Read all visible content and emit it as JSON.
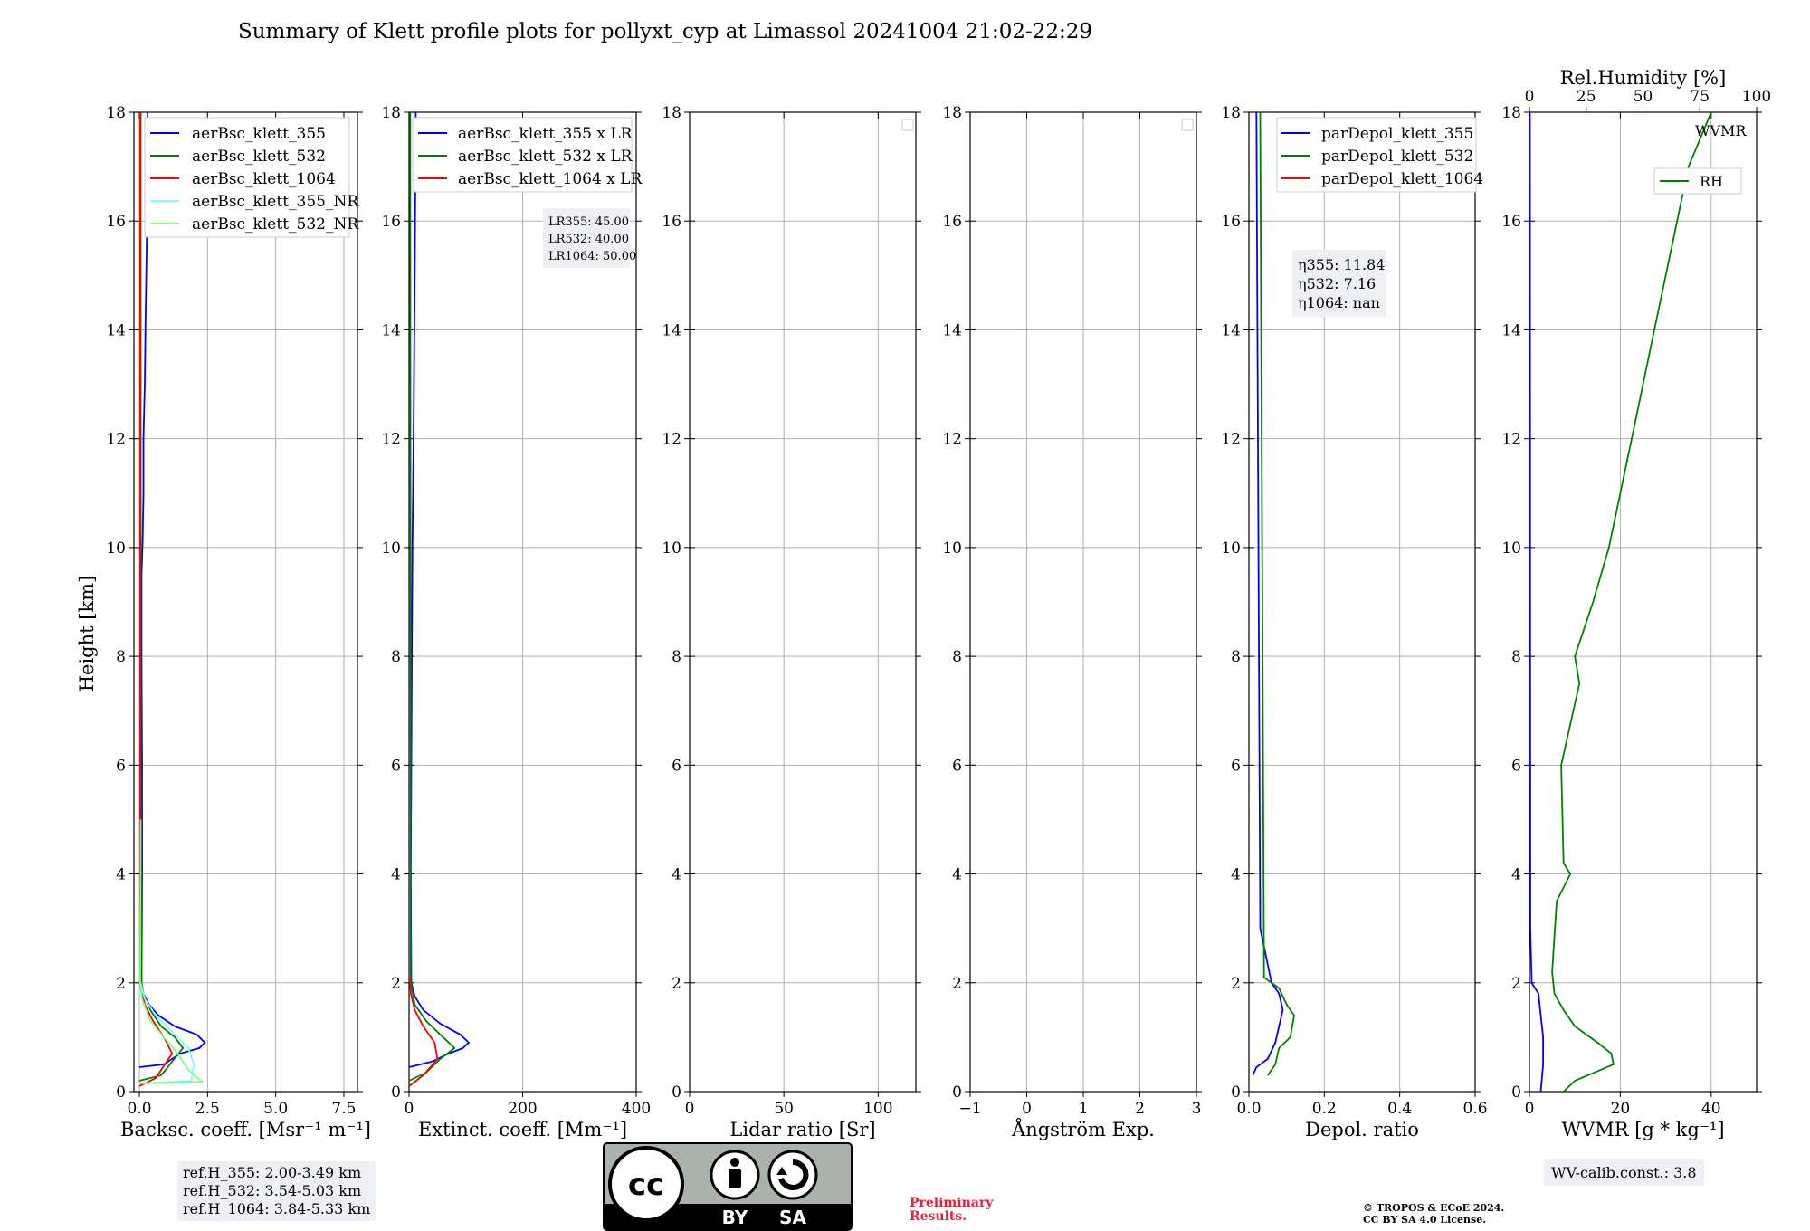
{
  "title": "Summary of Klett profile plots for pollyxt_cyp at Limassol 20241004 21:02-22:29",
  "ylabel": "Height [km]",
  "y_ticks": [
    "0",
    "2",
    "4",
    "6",
    "8",
    "10",
    "12",
    "14",
    "16",
    "18"
  ],
  "panels": [
    {
      "xlabel": "Backsc. coeff. [Msr⁻¹ m⁻¹]",
      "xticks": [
        "0.0",
        "2.5",
        "5.0",
        "7.5"
      ]
    },
    {
      "xlabel": "Extinct. coeff. [Mm⁻¹]",
      "xticks": [
        "0",
        "200",
        "400"
      ]
    },
    {
      "xlabel": "Lidar ratio [Sr]",
      "xticks": [
        "0",
        "50",
        "100"
      ]
    },
    {
      "xlabel": "Ångström Exp.",
      "xticks": [
        "−1",
        "0",
        "1",
        "2",
        "3"
      ]
    },
    {
      "xlabel": "Depol. ratio",
      "xticks": [
        "0.0",
        "0.2",
        "0.4",
        "0.6"
      ]
    },
    {
      "xlabel": "WVMR [g * kg⁻¹]",
      "xticks": [
        "0",
        "20",
        "40"
      ],
      "top_label": "Rel.Humidity [%]",
      "top_ticks": [
        "0",
        "25",
        "50",
        "75",
        "100"
      ]
    }
  ],
  "legends": {
    "bsc": [
      "aerBsc_klett_355",
      "aerBsc_klett_532",
      "aerBsc_klett_1064",
      "aerBsc_klett_355_NR",
      "aerBsc_klett_532_NR"
    ],
    "ext": [
      "aerBsc_klett_355 x LR",
      "aerBsc_klett_532 x LR",
      "aerBsc_klett_1064 x LR"
    ],
    "dep": [
      "parDepol_klett_355",
      "parDepol_klett_532",
      "parDepol_klett_1064"
    ],
    "wv": [
      "WVMR",
      "RH"
    ]
  },
  "lr_box": [
    "LR355: 45.00",
    "LR532: 40.00",
    "LR1064: 50.00"
  ],
  "eta_box": [
    "η355: 11.84",
    "η532: 7.16",
    "η1064: nan"
  ],
  "ref_box": [
    "ref.H_355: 2.00-3.49 km",
    "ref.H_532: 3.54-5.03 km",
    "ref.H_1064: 3.84-5.33 km"
  ],
  "wv_calib": "WV-calib.const.: 3.8",
  "preliminary": [
    "Preliminary",
    "Results."
  ],
  "copyright": [
    "© TROPOS & ECoE 2024.",
    "CC BY SA 4.0 License."
  ],
  "cc_badge": [
    "BY",
    "SA"
  ],
  "colors": {
    "ch355": "#0000ff",
    "ch532": "#008000",
    "ch1064": "#ff0000",
    "nr355": "#7fffff",
    "nr532": "#7fff7f",
    "grid": "#b0b0b0"
  },
  "chart_data": [
    {
      "type": "line",
      "panel": "backscatter",
      "xlim": [
        -0.2,
        8
      ],
      "ylim": [
        0,
        18
      ],
      "series": [
        {
          "name": "aerBsc_klett_355",
          "x": [
            0,
            0.9,
            1.5,
            2.2,
            2.4,
            2.1,
            1.3,
            0.7,
            0.35,
            0.15,
            0.08,
            0.1,
            0.1,
            0.08,
            0.08,
            0.12,
            0.15,
            0.15,
            0.2,
            0.22,
            0.25,
            0.28,
            0.3
          ],
          "y": [
            0.45,
            0.5,
            0.7,
            0.8,
            0.9,
            1.05,
            1.2,
            1.4,
            1.6,
            1.8,
            2.0,
            4,
            6,
            8,
            9.5,
            10.1,
            11,
            12,
            13,
            14,
            15,
            16,
            18
          ]
        },
        {
          "name": "aerBsc_klett_532",
          "x": [
            0,
            0.8,
            1.6,
            1.3,
            0.8,
            0.4,
            0.15,
            0.08,
            0.06,
            0.05,
            0.05,
            0.05
          ],
          "y": [
            0.2,
            0.3,
            0.8,
            1.0,
            1.2,
            1.5,
            1.8,
            2.0,
            4,
            6,
            10,
            18
          ]
        },
        {
          "name": "aerBsc_klett_1064",
          "x": [
            0,
            0.6,
            1.2,
            0.9,
            0.5,
            0.2,
            0.08,
            0.03,
            0.03,
            0.03
          ],
          "y": [
            0.1,
            0.25,
            0.7,
            1.0,
            1.3,
            1.6,
            1.9,
            2.1,
            10,
            18
          ]
        },
        {
          "name": "aerBsc_klett_355_NR",
          "x": [
            0,
            1.9,
            2.0,
            1.8,
            1.2,
            0.6,
            0.2,
            0.05
          ],
          "y": [
            0.15,
            0.2,
            0.5,
            0.8,
            1.1,
            1.4,
            1.7,
            2.0
          ]
        },
        {
          "name": "aerBsc_klett_532_NR",
          "x": [
            0,
            2.3,
            1.8,
            1.4,
            0.9,
            0.4,
            0.1,
            0.03,
            0.05
          ],
          "y": [
            0.15,
            0.18,
            0.4,
            0.7,
            1.0,
            1.3,
            1.7,
            2.0,
            5
          ]
        }
      ]
    },
    {
      "type": "line",
      "panel": "extinction",
      "xlim": [
        0,
        400
      ],
      "ylim": [
        0,
        18
      ],
      "series": [
        {
          "name": "aerBsc_klett_355 x LR",
          "x": [
            0,
            40,
            70,
            95,
            105,
            90,
            55,
            25,
            10,
            4,
            3,
            5,
            6,
            8,
            10,
            12
          ],
          "y": [
            0.45,
            0.55,
            0.7,
            0.8,
            0.9,
            1.05,
            1.25,
            1.5,
            1.75,
            2.0,
            4,
            8,
            10.1,
            12,
            15,
            18
          ]
        },
        {
          "name": "aerBsc_klett_532 x LR",
          "x": [
            0,
            30,
            55,
            80,
            60,
            30,
            10,
            3,
            2
          ],
          "y": [
            0.2,
            0.35,
            0.6,
            0.8,
            1.0,
            1.3,
            1.6,
            2.0,
            18
          ]
        },
        {
          "name": "aerBsc_klett_1064 x LR",
          "x": [
            0,
            25,
            50,
            45,
            25,
            10,
            3,
            1
          ],
          "y": [
            0.1,
            0.3,
            0.6,
            0.9,
            1.2,
            1.5,
            1.8,
            2.1
          ]
        }
      ]
    },
    {
      "type": "line",
      "panel": "lidar_ratio",
      "xlim": [
        0,
        120
      ],
      "ylim": [
        0,
        18
      ],
      "series": []
    },
    {
      "type": "line",
      "panel": "angstrom",
      "xlim": [
        -1,
        3
      ],
      "ylim": [
        0,
        18
      ],
      "series": []
    },
    {
      "type": "line",
      "panel": "depolarization",
      "xlim": [
        0,
        0.6
      ],
      "ylim": [
        0,
        18
      ],
      "series": [
        {
          "name": "parDepol_klett_355",
          "x": [
            0.01,
            0.02,
            0.05,
            0.07,
            0.08,
            0.09,
            0.08,
            0.06,
            0.03,
            0.02
          ],
          "y": [
            0.3,
            0.45,
            0.6,
            0.9,
            1.2,
            1.5,
            1.8,
            2.0,
            3,
            18
          ]
        },
        {
          "name": "parDepol_klett_532",
          "x": [
            0.05,
            0.07,
            0.08,
            0.11,
            0.12,
            0.1,
            0.08,
            0.04,
            0.03
          ],
          "y": [
            0.3,
            0.5,
            0.8,
            1.0,
            1.4,
            1.6,
            1.9,
            2.1,
            18
          ]
        }
      ]
    },
    {
      "type": "line",
      "panel": "water_vapor",
      "xlim": [
        0,
        50
      ],
      "ylim": [
        0,
        18
      ],
      "top_xlim": [
        0,
        100
      ],
      "series": [
        {
          "name": "WVMR",
          "x": [
            2.5,
            3,
            3,
            2.5,
            2,
            0.5,
            0.2,
            0.1
          ],
          "y": [
            0,
            0.5,
            1.0,
            1.4,
            1.8,
            2.0,
            3.0,
            18
          ]
        },
        {
          "name": "RH",
          "x": [
            15,
            20,
            37,
            36,
            30,
            20,
            15,
            11,
            10,
            12,
            18,
            15,
            14,
            22,
            20,
            28,
            35,
            40,
            45,
            50,
            55,
            60,
            65,
            70,
            75,
            80
          ],
          "y": [
            0,
            0.2,
            0.5,
            0.7,
            0.9,
            1.2,
            1.5,
            1.8,
            2.2,
            3.5,
            4.0,
            4.2,
            6.0,
            7.5,
            8.0,
            9.0,
            10.0,
            11.0,
            12.0,
            13,
            14,
            15,
            16,
            17,
            17.5,
            18
          ]
        }
      ]
    }
  ]
}
